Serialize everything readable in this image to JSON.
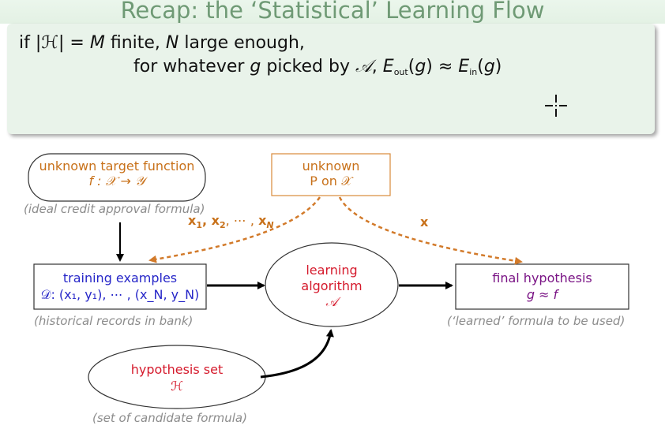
{
  "title": "Recap: the ‘Statistical’ Learning Flow",
  "recap": {
    "line1": {
      "p1": "if |",
      "H": "ℋ",
      "p2": "| = ",
      "M": "M",
      "p3": " finite, ",
      "N": "N",
      "p4": " large enough,"
    },
    "line2": {
      "p1": "for whatever ",
      "g": "g",
      "p2": " picked by ",
      "A": "𝒜",
      "p3": ", ",
      "E1": "E",
      "sub1": "out",
      "p4": "(",
      "g2": "g",
      "p5": ") ≈ ",
      "E2": "E",
      "sub2": "in",
      "p6": "(",
      "g3": "g",
      "p7": ")"
    }
  },
  "diagram": {
    "target": {
      "line1": "unknown target function",
      "line2": "f : 𝒳 → 𝒴"
    },
    "target_caption": "(ideal credit approval formula)",
    "distribution": {
      "line1": "unknown",
      "line2": "P on 𝒳"
    },
    "samples_label": {
      "x1": "x",
      "s1": "1",
      "sep1": ", ",
      "x2": "x",
      "s2": "2",
      "dots": ", ⋯ , ",
      "xn": "x",
      "sn": "N"
    },
    "x_label": "x",
    "training": {
      "line1": "training examples",
      "line2": "𝒟: (x₁, y₁), ⋯ , (x_N, y_N)"
    },
    "training_caption": "(historical records in bank)",
    "algorithm": {
      "line1": "learning",
      "line2": "algorithm",
      "line3": "𝒜"
    },
    "final": {
      "line1": "final hypothesis",
      "line2": "g ≈ f"
    },
    "final_caption": "(‘learned’ formula to be used)",
    "hypothesis": {
      "line1": "hypothesis set",
      "line2": "ℋ"
    },
    "hypothesis_caption": "(set of candidate formula)"
  },
  "colors": {
    "title": "#6f9a75",
    "orange": "#c8711a",
    "blue": "#2626c8",
    "red": "#d51a2c",
    "purple": "#7a1485",
    "caption": "#8c8c8c"
  }
}
